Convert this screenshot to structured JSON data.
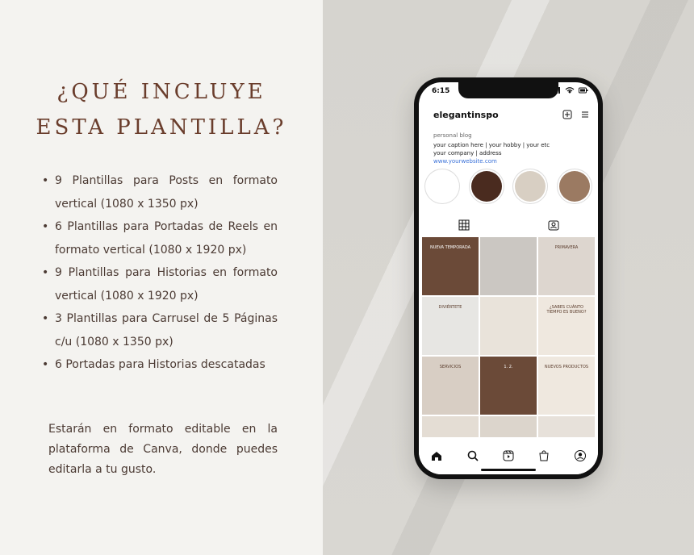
{
  "left": {
    "title_lines": [
      "¿QUÉ INCLUYE",
      "ESTA PLANTILLA?"
    ],
    "bullets": [
      "9 Plantillas para Posts en formato vertical (1080 x 1350 px)",
      "6 Plantillas para Portadas de Reels en formato vertical (1080 x 1920 px)",
      "9 Plantillas para Historias en formato vertical (1080 x 1920 px)",
      "3 Plantillas para Carrusel de 5 Páginas c/u (1080 x 1350 px)",
      "6 Portadas para Historias descatadas"
    ],
    "paragraph": "Estarán en formato editable en la plataforma de Canva, donde puedes editarla a tu gusto."
  },
  "phone": {
    "time": "6:15",
    "username": "elegantinspo",
    "bio": {
      "label": "personal blog",
      "lines": [
        "your caption here | your hobby | your etc",
        "your company | address"
      ],
      "link": "www.yourwebsite.com"
    },
    "highlights": [
      {
        "label": "",
        "color": "#ffffff"
      },
      {
        "label": "",
        "color": "#4a2b1f"
      },
      {
        "label": "",
        "color": "#d8cfc3"
      },
      {
        "label": "",
        "color": "#9b7a62"
      }
    ],
    "grid": [
      {
        "text": "NUEVA TEMPORADA",
        "bg": "#6b4a38",
        "light": true
      },
      {
        "text": "",
        "bg": "#cbc7c2",
        "light": false
      },
      {
        "text": "PRIMAVERA",
        "bg": "#ddd6cf",
        "light": false
      },
      {
        "text": "DIVIÉRTETE",
        "bg": "#e7e6e3",
        "light": false
      },
      {
        "text": "",
        "bg": "#e9e3da",
        "light": false
      },
      {
        "text": "¿SABES CUÁNTO TIEMPO ES BUENO?",
        "bg": "#efe8df",
        "light": false
      },
      {
        "text": "SERVICIOS",
        "bg": "#d8cec4",
        "light": false
      },
      {
        "text": "1. 2.",
        "bg": "#6b4a38",
        "light": true
      },
      {
        "text": "NUEVOS PRODUCTOS",
        "bg": "#efe8df",
        "light": false
      },
      {
        "text": "",
        "bg": "#e4ddd4",
        "light": false
      },
      {
        "text": "",
        "bg": "#dcd5cc",
        "light": false
      },
      {
        "text": "",
        "bg": "#e7e1da",
        "light": false
      }
    ]
  },
  "colors": {
    "accent": "#6a3d2c",
    "brown_dark": "#4a2b1f",
    "link_blue": "#3b72d9"
  }
}
